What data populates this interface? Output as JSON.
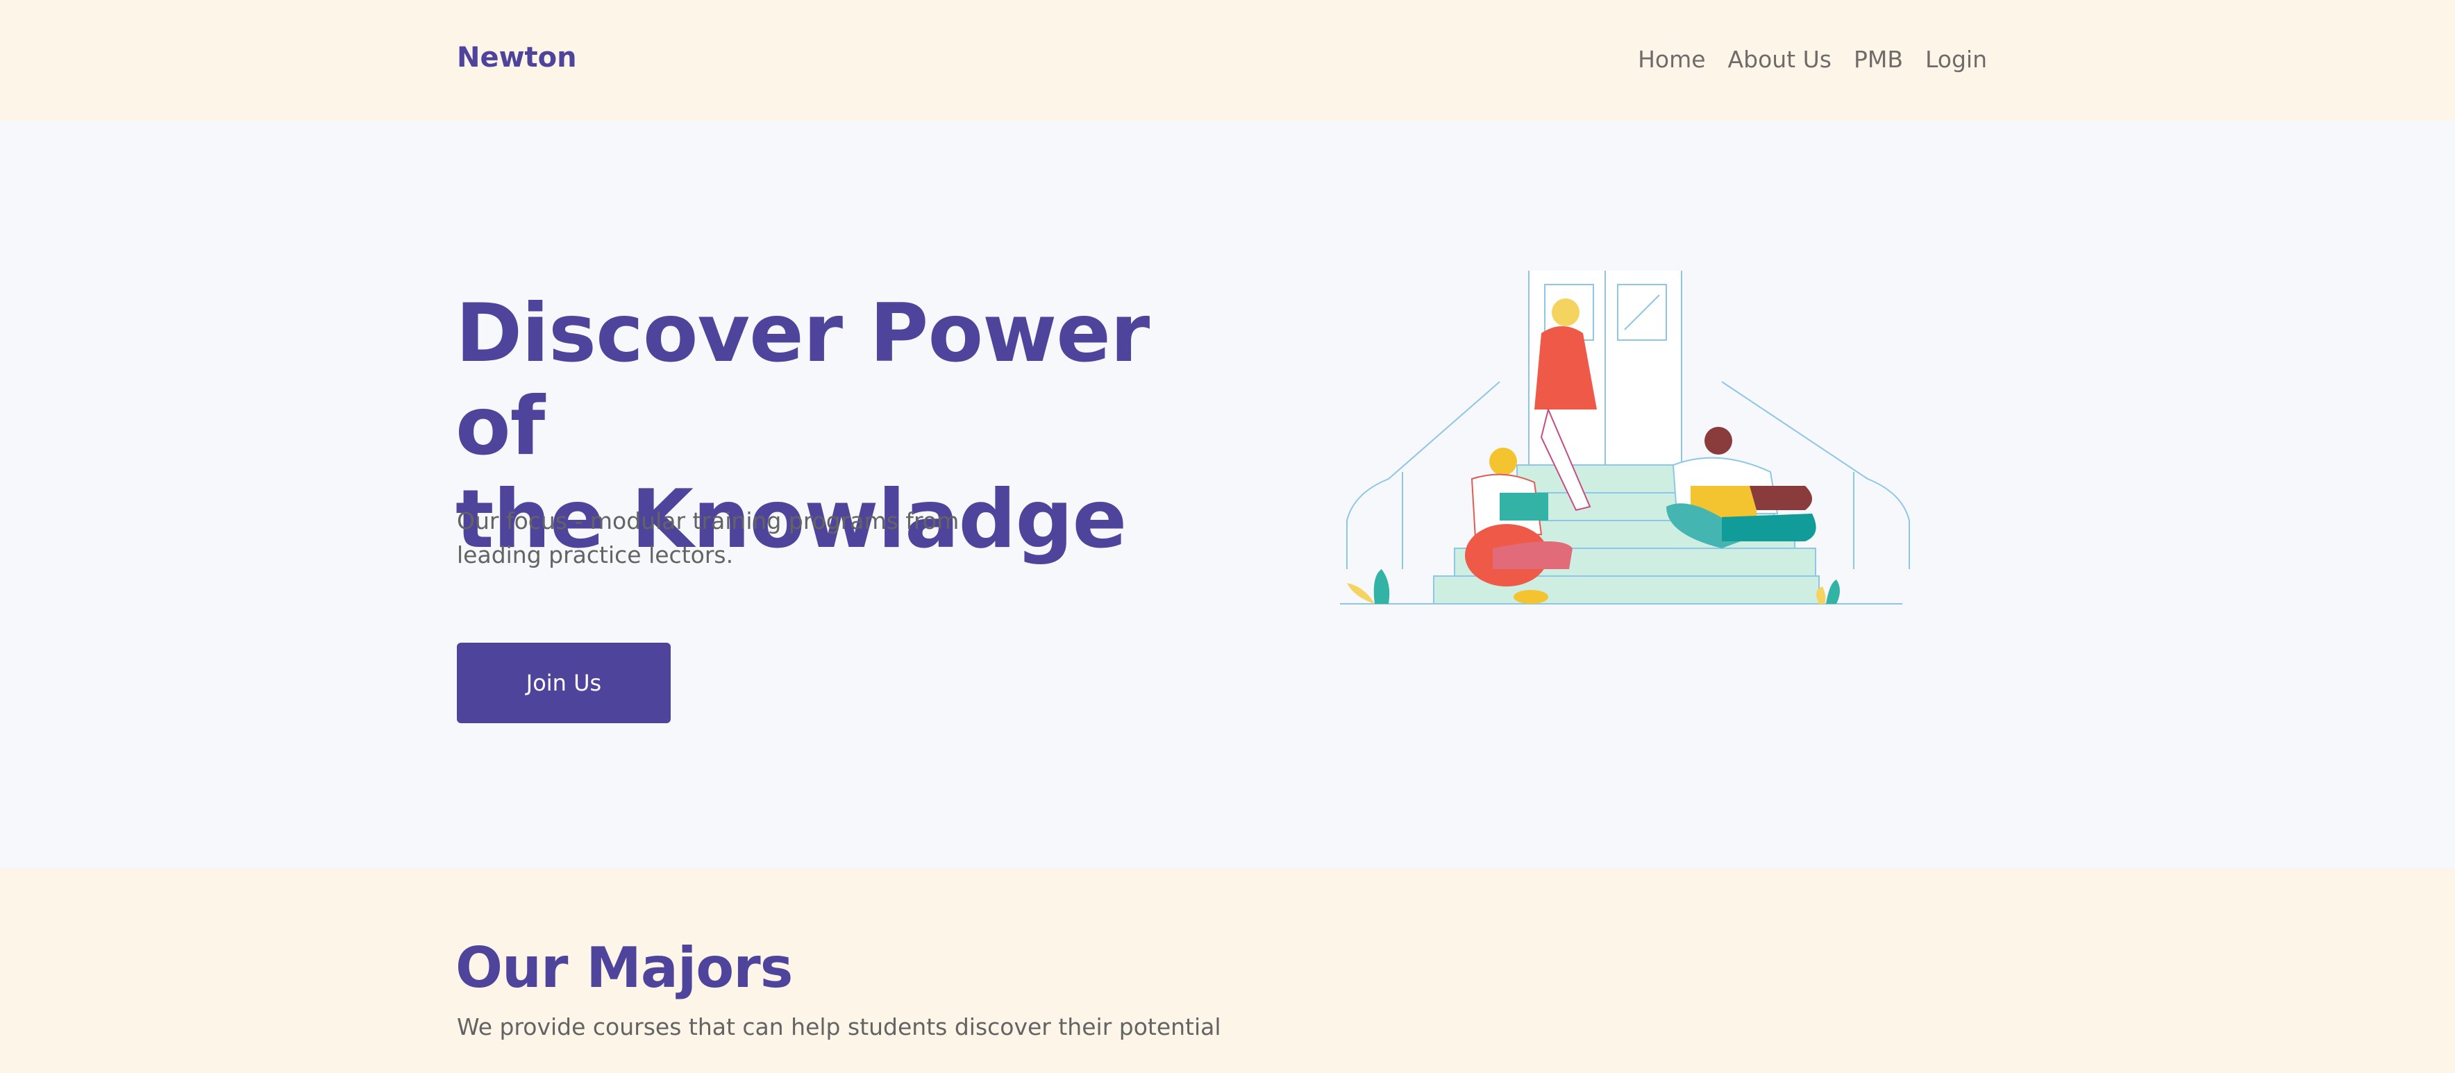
{
  "navbar": {
    "brand": "Newton",
    "links": [
      "Home",
      "About Us",
      "PMB",
      "Login"
    ]
  },
  "hero": {
    "title_line1": "Discover Power of",
    "title_line2": "the Knowladge",
    "subtitle_line1": "Our focus - modular training programs from",
    "subtitle_line2": "leading practice lectors.",
    "cta_label": "Join Us",
    "illustration": "students-on-steps-illustration"
  },
  "majors": {
    "title": "Our Majors",
    "subtitle": "We provide courses that can help students discover their potential"
  },
  "colors": {
    "brand_purple": "#4f449c",
    "header_cream": "#fdf5e8",
    "hero_bg": "#f7f8fb",
    "body_text": "#636363"
  }
}
